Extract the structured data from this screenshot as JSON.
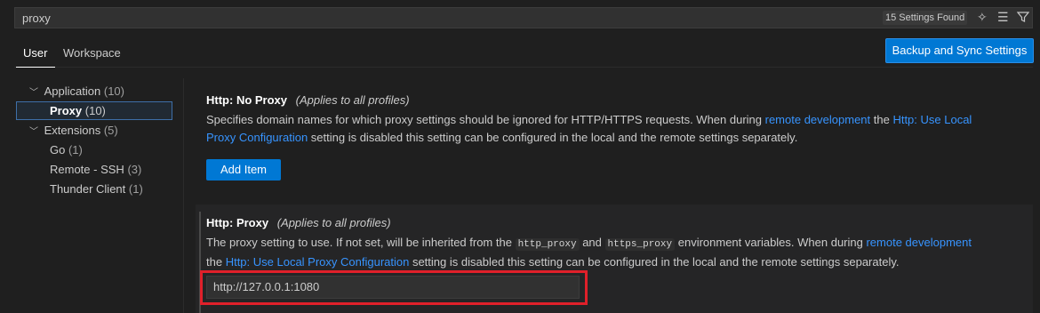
{
  "search": {
    "query": "proxy",
    "found": "15 Settings Found"
  },
  "tabs": [
    {
      "label": "User"
    },
    {
      "label": "Workspace"
    }
  ],
  "sync_button": {
    "label": "Backup and Sync Settings"
  },
  "tree": {
    "application": {
      "label": "Application",
      "count": "(10)"
    },
    "proxy": {
      "label": "Proxy",
      "count": "(10)"
    },
    "extensions": {
      "label": "Extensions",
      "count": "(5)"
    },
    "go": {
      "label": "Go",
      "count": "(1)"
    },
    "remote_ssh": {
      "label": "Remote - SSH",
      "count": "(3)"
    },
    "thunder": {
      "label": "Thunder Client",
      "count": "(1)"
    }
  },
  "no_proxy": {
    "category": "Http: ",
    "name": "No Proxy",
    "scope": "(Applies to all profiles)",
    "desc_1": "Specifies domain names for which proxy settings should be ignored for HTTP/HTTPS requests. When during ",
    "link_1": "remote development",
    "desc_2": " the ",
    "link_2a": "Http: Use Local",
    "link_2b": "Proxy Configuration",
    "desc_3": " setting is disabled this setting can be configured in the local and the remote settings separately.",
    "add_button": "Add Item"
  },
  "proxy": {
    "category": "Http: ",
    "name": "Proxy",
    "scope": "(Applies to all profiles)",
    "desc_1": "The proxy setting to use. If not set, will be inherited from the ",
    "code_1": "http_proxy",
    "desc_2": " and ",
    "code_2": "https_proxy",
    "desc_3": " environment variables. When during ",
    "link_1": "remote development",
    "desc_4": "the ",
    "link_2": "Http: Use Local Proxy Configuration",
    "desc_5": " setting is disabled this setting can be configured in the local and the remote settings separately.",
    "value": "http://127.0.0.1:1080"
  },
  "colors": {
    "accent": "#0078d4",
    "link": "#3794ff",
    "highlight": "#e0202a"
  }
}
